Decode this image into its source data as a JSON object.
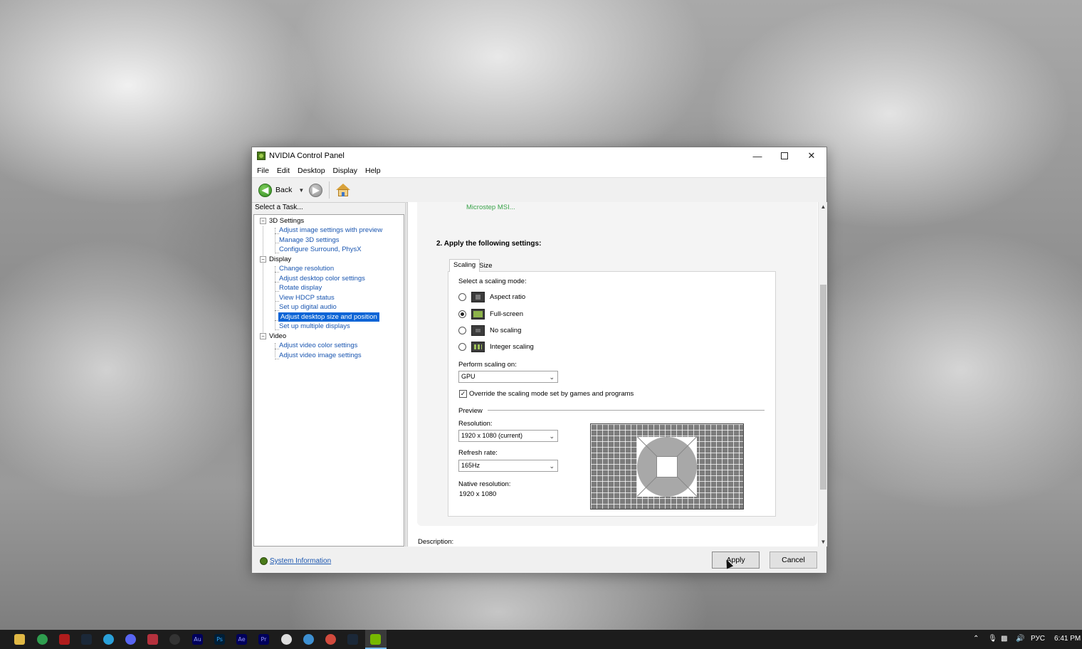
{
  "window": {
    "title": "NVIDIA Control Panel",
    "controls": {
      "minimize": "—",
      "close": "✕"
    }
  },
  "menubar": [
    "File",
    "Edit",
    "Desktop",
    "Display",
    "Help"
  ],
  "toolbar": {
    "back_label": "Back"
  },
  "left_panel": {
    "label": "Select a Task...",
    "tree": [
      {
        "type": "category",
        "label": "3D Settings"
      },
      {
        "type": "link",
        "label": "Adjust image settings with preview"
      },
      {
        "type": "link",
        "label": "Manage 3D settings"
      },
      {
        "type": "link",
        "label": "Configure Surround, PhysX"
      },
      {
        "type": "category",
        "label": "Display"
      },
      {
        "type": "link",
        "label": "Change resolution"
      },
      {
        "type": "link",
        "label": "Adjust desktop color settings"
      },
      {
        "type": "link",
        "label": "Rotate display"
      },
      {
        "type": "link",
        "label": "View HDCP status"
      },
      {
        "type": "link",
        "label": "Set up digital audio"
      },
      {
        "type": "link",
        "label": "Adjust desktop size and position",
        "selected": true
      },
      {
        "type": "link",
        "label": "Set up multiple displays"
      },
      {
        "type": "category",
        "label": "Video"
      },
      {
        "type": "link",
        "label": "Adjust video color settings"
      },
      {
        "type": "link",
        "label": "Adjust video image settings"
      }
    ]
  },
  "content": {
    "display_name": "Microstep MSI...",
    "section_heading": "2. Apply the following settings:",
    "tabs": [
      {
        "label": "Scaling",
        "active": true
      },
      {
        "label": "Size",
        "active": false
      }
    ],
    "scaling_mode_label": "Select a scaling mode:",
    "scaling_modes": [
      {
        "label": "Aspect ratio",
        "checked": false,
        "icon": "aspect-ratio-icon"
      },
      {
        "label": "Full-screen",
        "checked": true,
        "icon": "full-screen-icon"
      },
      {
        "label": "No scaling",
        "checked": false,
        "icon": "no-scaling-icon"
      },
      {
        "label": "Integer scaling",
        "checked": false,
        "icon": "integer-scaling-icon"
      }
    ],
    "perform_scaling_label": "Perform scaling on:",
    "perform_scaling_value": "GPU",
    "override_label": "Override the scaling mode set by games and programs",
    "override_checked": true,
    "preview_label": "Preview",
    "resolution_label": "Resolution:",
    "resolution_value": "1920 x 1080 (current)",
    "refresh_label": "Refresh rate:",
    "refresh_value": "165Hz",
    "native_label": "Native resolution:",
    "native_value": "1920 x 1080",
    "description_label": "Description:"
  },
  "bottom": {
    "system_info_link": "System Information",
    "apply_label": "Apply",
    "cancel_label": "Cancel"
  },
  "taskbar": {
    "language": "РУС",
    "time": "6:41 PM"
  },
  "colors": {
    "link": "#1a56b0",
    "selection": "#0a64d6",
    "display_name_green": "#3aa34a",
    "taskbar": "#1c1c1c"
  }
}
